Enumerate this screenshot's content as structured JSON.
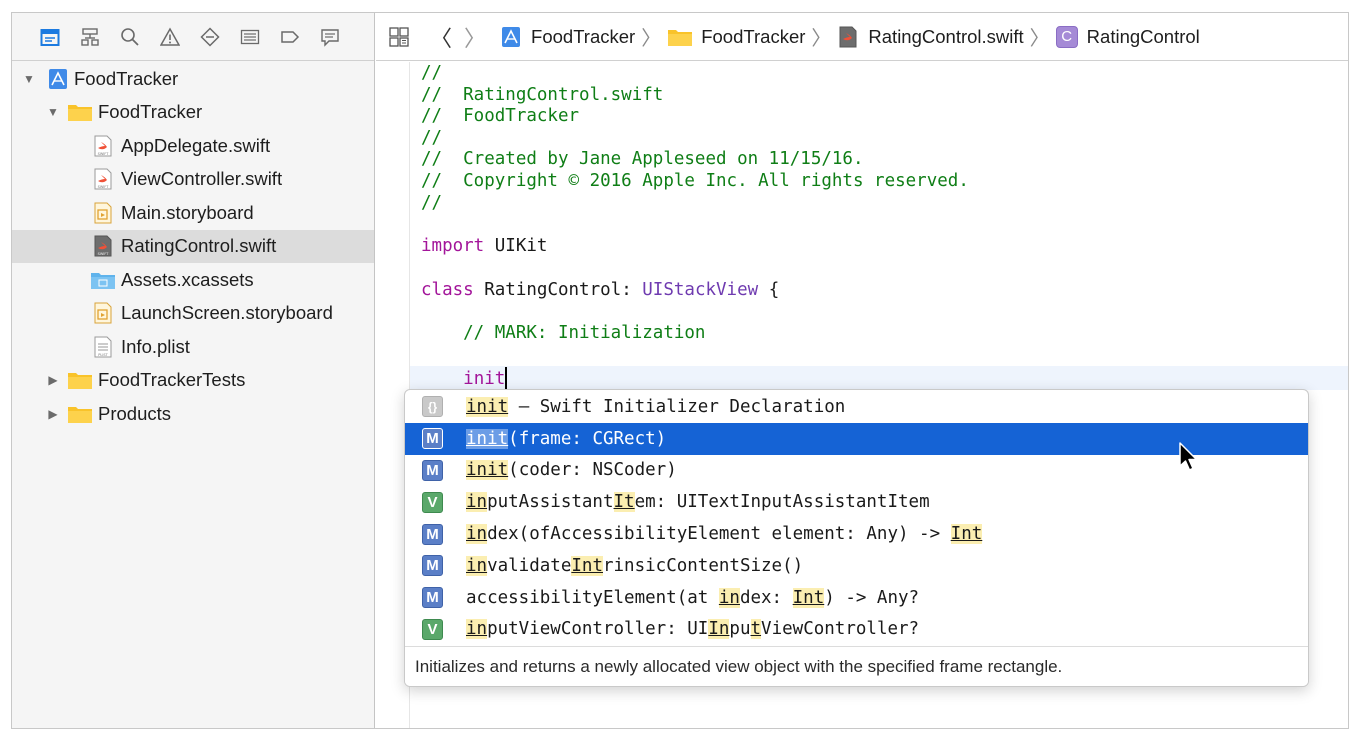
{
  "navigator": {
    "tools": [
      "project-navigator-icon",
      "hierarchy-icon",
      "search-icon",
      "warning-icon",
      "test-icon",
      "debug-icon",
      "breakpoint-icon",
      "report-icon"
    ],
    "tree": [
      {
        "label": "FoodTracker",
        "kind": "project",
        "level": 0,
        "expanded": true
      },
      {
        "label": "FoodTracker",
        "kind": "folder",
        "level": 1,
        "expanded": true
      },
      {
        "label": "AppDelegate.swift",
        "kind": "swift",
        "level": 2
      },
      {
        "label": "ViewController.swift",
        "kind": "swift",
        "level": 2
      },
      {
        "label": "Main.storyboard",
        "kind": "storyboard",
        "level": 2
      },
      {
        "label": "RatingControl.swift",
        "kind": "swift",
        "level": 2,
        "selected": true
      },
      {
        "label": "Assets.xcassets",
        "kind": "assets",
        "level": 2
      },
      {
        "label": "LaunchScreen.storyboard",
        "kind": "storyboard",
        "level": 2
      },
      {
        "label": "Info.plist",
        "kind": "plist",
        "level": 2
      },
      {
        "label": "FoodTrackerTests",
        "kind": "folder",
        "level": 1,
        "expanded": false
      },
      {
        "label": "Products",
        "kind": "folder",
        "level": 1,
        "expanded": false
      }
    ]
  },
  "jumpbar": {
    "project": "FoodTracker",
    "group": "FoodTracker",
    "file": "RatingControl.swift",
    "symbol": "RatingControl",
    "symbol_badge": "C"
  },
  "code": {
    "lines": [
      "//",
      "//  RatingControl.swift",
      "//  FoodTracker",
      "//",
      "//  Created by Jane Appleseed on 11/15/16.",
      "//  Copyright © 2016 Apple Inc. All rights reserved.",
      "//"
    ],
    "import_kw": "import",
    "import_mod": " UIKit",
    "class_kw": "class",
    "class_name": " RatingControl: ",
    "class_super": "UIStackView",
    "class_brace": " {",
    "mark": "    // MARK: Initialization",
    "typed_indent": "    ",
    "typed": "init"
  },
  "completion": {
    "items": [
      {
        "badge": "{}",
        "kind": "snip"
      },
      {
        "badge": "M",
        "kind": "m",
        "selected": true
      },
      {
        "badge": "M",
        "kind": "m"
      },
      {
        "badge": "V",
        "kind": "v"
      },
      {
        "badge": "M",
        "kind": "m"
      },
      {
        "badge": "M",
        "kind": "m"
      },
      {
        "badge": "M",
        "kind": "m"
      },
      {
        "badge": "V",
        "kind": "v"
      }
    ],
    "row0": {
      "a": "init",
      "b": " – Swift Initializer Declaration"
    },
    "row1": {
      "a": "init",
      "b": "(frame: CGRect)"
    },
    "row2": {
      "a": "init",
      "b": "(coder: NSCoder)"
    },
    "row3": {
      "a": "in",
      "b": "putAssistant",
      "c": "It",
      "d": "em: UITextInputAssistantItem"
    },
    "row4": {
      "a": "in",
      "b": "dex(ofAccessibilityElement element: Any) -> ",
      "c": "Int"
    },
    "row5": {
      "a": "in",
      "b": "validate",
      "c": "Int",
      "d": "rinsicContentSize()"
    },
    "row6": {
      "a": "accessibilityElement(at ",
      "b": "in",
      "c": "dex: ",
      "d": "Int",
      "e": ") -> Any?"
    },
    "row7": {
      "a": "in",
      "b": "putViewController: UI",
      "c": "In",
      "d": "pu",
      "e": "t",
      "f": "ViewController?"
    },
    "description": "Initializes and returns a newly allocated view object with the specified frame rectangle."
  }
}
